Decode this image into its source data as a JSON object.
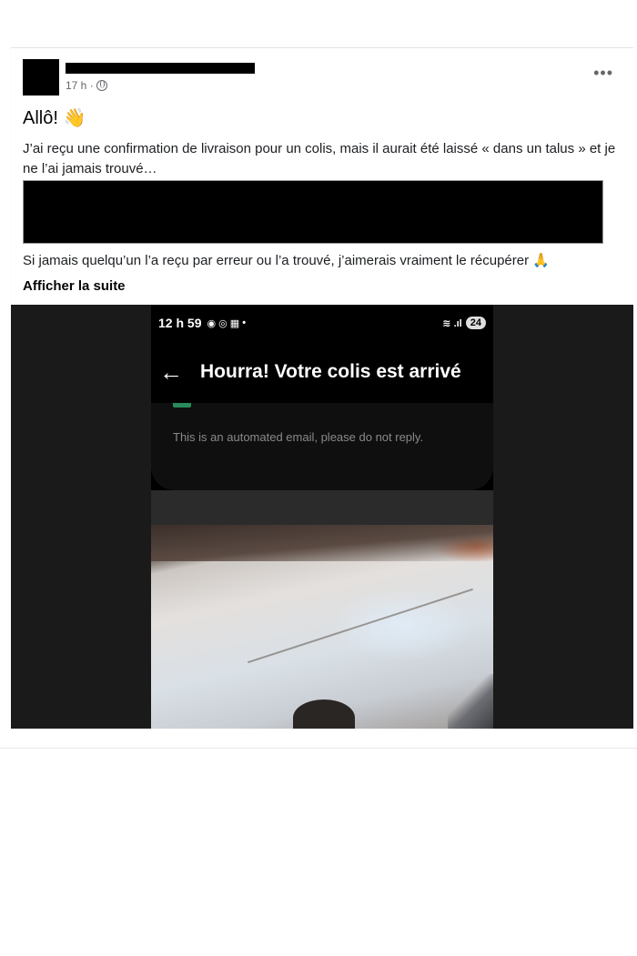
{
  "post": {
    "timestamp": "17 h ·",
    "greeting": "Allô! 👋",
    "paragraph1": "J’ai reçu une confirmation de livraison pour un colis, mais il aurait été laissé « dans un talus » et je ne l’ai jamais trouvé…",
    "paragraph2": "Si jamais quelqu’un l’a reçu par erreur ou l’a trouvé, j’aimerais vraiment le récupérer 🙏",
    "see_more": "Afficher la suite",
    "more_icon": "•••"
  },
  "screenshot": {
    "status_time": "12 h 59",
    "status_dot": "•",
    "status_icons_left": "◉ ◎ ▦",
    "status_icons_right": "≋ .ıl",
    "battery": "24",
    "back_icon": "←",
    "title": "Hourra! Votre colis est arrivé",
    "automated_text": "This is an automated email, please do not reply."
  },
  "colors": {
    "text_primary": "#050505",
    "text_secondary": "#65676b",
    "media_bg": "#1a1a1a"
  }
}
